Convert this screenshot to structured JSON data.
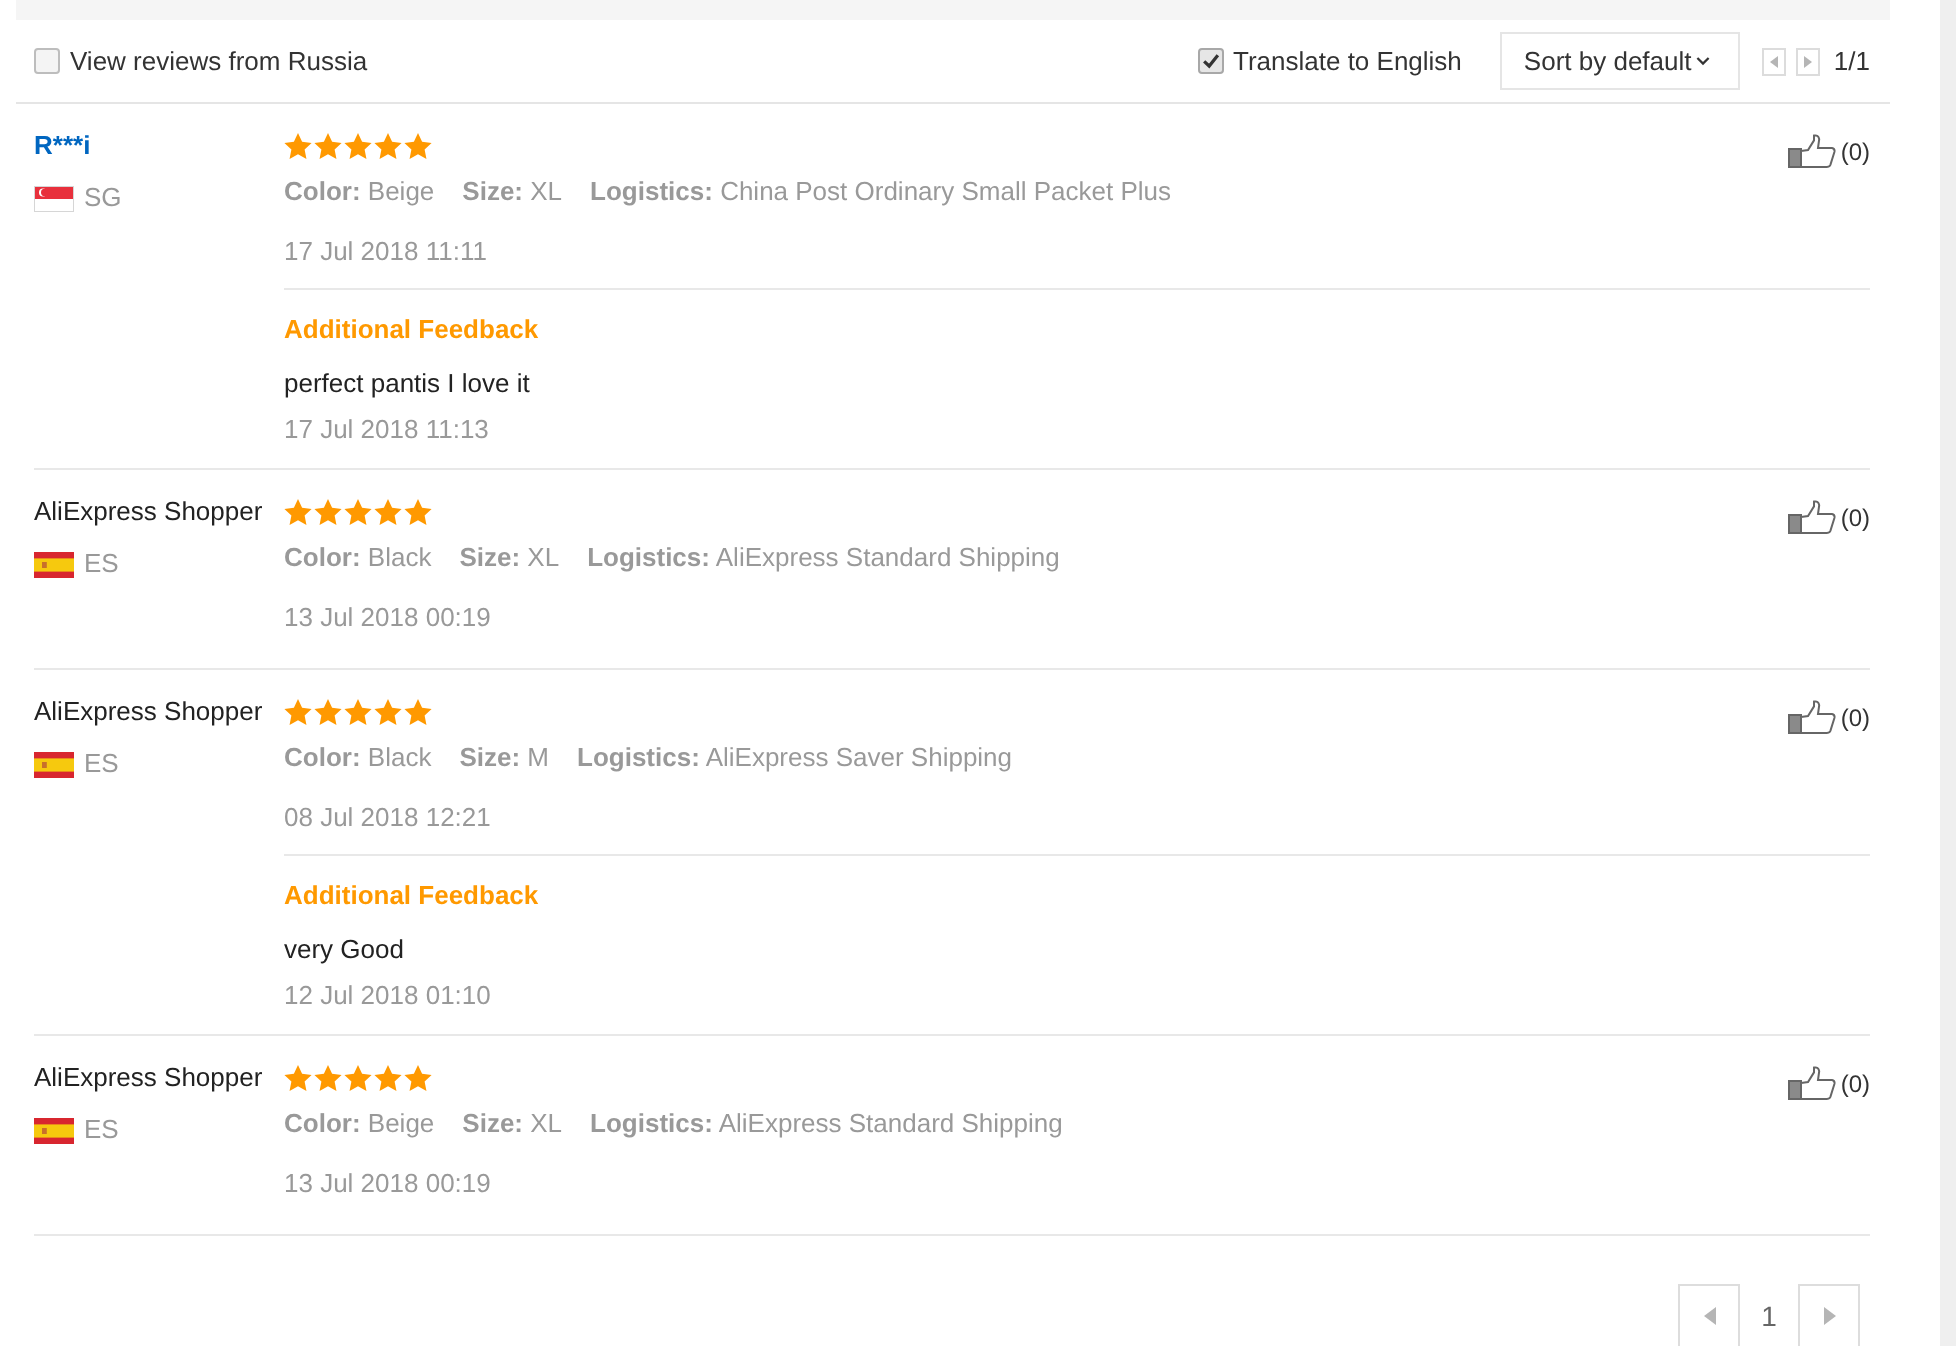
{
  "filters": {
    "country_filter": {
      "label": "View reviews from Russia",
      "checked": false
    },
    "translate": {
      "label": "Translate to English",
      "checked": true
    },
    "sort": {
      "label": "Sort by default"
    },
    "page_indicator": "1/1"
  },
  "reviews": [
    {
      "name": "R***i",
      "linked": true,
      "flag": {
        "kind": "singapore"
      },
      "country": "SG",
      "stars": 5,
      "attributes": [
        {
          "label": "Color:",
          "value": "Beige"
        },
        {
          "label": "Size:",
          "value": "XL"
        },
        {
          "label": "Logistics:",
          "value": "China Post Ordinary Small Packet Plus"
        }
      ],
      "date": "17 Jul 2018 11:11",
      "helpful": "(0)",
      "additional": {
        "heading": "Additional Feedback",
        "text": "perfect pantis I love it",
        "date": "17 Jul 2018 11:13"
      }
    },
    {
      "name": "AliExpress Shopper",
      "linked": false,
      "flag": {
        "kind": "spain"
      },
      "country": "ES",
      "stars": 5,
      "attributes": [
        {
          "label": "Color:",
          "value": "Black"
        },
        {
          "label": "Size:",
          "value": "XL"
        },
        {
          "label": "Logistics:",
          "value": "AliExpress Standard Shipping"
        }
      ],
      "date": "13 Jul 2018 00:19",
      "helpful": "(0)"
    },
    {
      "name": "AliExpress Shopper",
      "linked": false,
      "flag": {
        "kind": "spain"
      },
      "country": "ES",
      "stars": 5,
      "attributes": [
        {
          "label": "Color:",
          "value": "Black"
        },
        {
          "label": "Size:",
          "value": "M"
        },
        {
          "label": "Logistics:",
          "value": "AliExpress Saver Shipping"
        }
      ],
      "date": "08 Jul 2018 12:21",
      "helpful": "(0)",
      "additional": {
        "heading": "Additional Feedback",
        "text": "very Good",
        "date": "12 Jul 2018 01:10"
      }
    },
    {
      "name": "AliExpress Shopper",
      "linked": false,
      "flag": {
        "kind": "spain"
      },
      "country": "ES",
      "stars": 5,
      "attributes": [
        {
          "label": "Color:",
          "value": "Beige"
        },
        {
          "label": "Size:",
          "value": "XL"
        },
        {
          "label": "Logistics:",
          "value": "AliExpress Standard Shipping"
        }
      ],
      "date": "13 Jul 2018 00:19",
      "helpful": "(0)"
    }
  ],
  "pagination": {
    "pages": [
      {
        "label": "1",
        "selected": true
      }
    ]
  }
}
